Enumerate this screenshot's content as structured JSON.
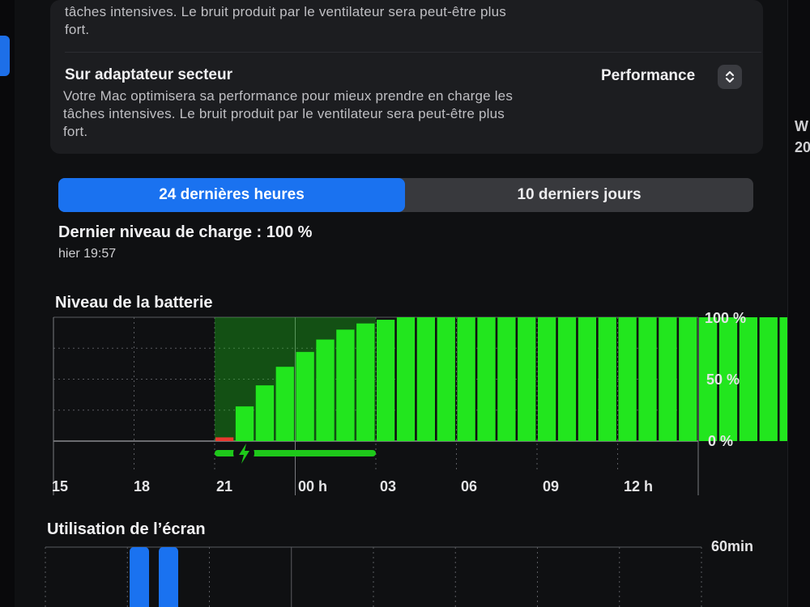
{
  "top_text_fragment": {
    "line1": "tâches intensives. Le bruit produit par le ventilateur sera peut-être plus",
    "line2": "fort."
  },
  "power_adapter": {
    "title": "Sur adaptateur secteur",
    "desc1": "Votre Mac optimisera sa performance pour mieux prendre en charge les",
    "desc2": "tâches intensives. Le bruit produit par le ventilateur sera peut-être plus",
    "desc3": "fort.",
    "mode": "Performance",
    "stepper_icon": "chevron-up-down-icon"
  },
  "tabs": {
    "active": "24 dernières heures",
    "inactive": "10 derniers jours"
  },
  "last_charge": {
    "label": "Dernier niveau de charge : 100 %",
    "time": "hier 19:57"
  },
  "right_edge": {
    "w": "W",
    "n": "20"
  },
  "colors": {
    "accent": "#1a72f0",
    "battery_green": "#22e61e",
    "low_red": "#e8392f",
    "charging_green": "#1ec81a"
  },
  "battery_chart": {
    "title": "Niveau de la batterie",
    "y_ticks": [
      "100 %",
      "50 %",
      "0 %"
    ],
    "x_ticks": [
      "15",
      "18",
      "21",
      "00 h",
      "03",
      "06",
      "09",
      "12 h"
    ],
    "charging_icon": "bolt-icon"
  },
  "screen_chart": {
    "title": "Utilisation de l’écran",
    "y_top": "60min"
  },
  "chart_data": [
    {
      "type": "bar",
      "title": "Niveau de la batterie",
      "ylim": [
        0,
        100
      ],
      "y_ticks": [
        "100 %",
        "50 %",
        "0 %"
      ],
      "x_ticks": [
        "15",
        "18",
        "21",
        "00 h",
        "03",
        "06",
        "09",
        "12 h"
      ],
      "grid": true,
      "interval_minutes": 15,
      "start_slot": 8,
      "values": [
        3,
        28,
        45,
        60,
        72,
        82,
        90,
        95,
        98,
        100,
        100,
        100,
        100,
        100,
        100,
        100,
        100,
        100,
        100,
        100,
        100,
        100,
        100,
        100,
        100,
        100,
        100,
        100,
        100,
        100,
        100,
        100,
        100,
        100,
        100,
        100,
        100,
        100,
        100,
        100,
        100,
        100,
        100,
        100,
        100,
        100,
        100,
        100,
        100,
        100,
        100,
        100,
        100,
        100,
        100,
        100,
        100,
        100,
        100,
        100,
        100,
        100,
        100,
        100,
        100,
        100,
        100,
        100,
        100,
        100,
        100,
        100,
        100,
        100,
        100,
        100,
        100,
        100,
        100,
        100,
        100,
        100,
        100
      ],
      "charging_range_slots": [
        8,
        16
      ]
    },
    {
      "type": "bar",
      "title": "Utilisation de l’écran",
      "y_ticks": [
        "60min"
      ],
      "x_ticks": [
        "15",
        "18",
        "21",
        "00 h",
        "03",
        "06",
        "09",
        "12 h"
      ],
      "grid": true,
      "bars": [
        {
          "hour_slot": 3,
          "slot_fraction_start": 0.05,
          "value_min": 60
        },
        {
          "hour_slot": 4,
          "slot_fraction_start": 0.05,
          "value_min": 60
        }
      ]
    }
  ]
}
